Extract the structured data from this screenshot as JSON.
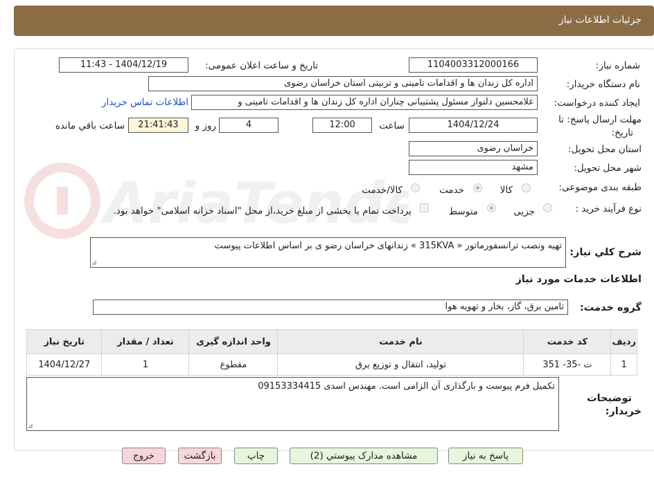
{
  "header": {
    "title": "جزئیات اطلاعات نیاز"
  },
  "fields": {
    "need_number_label": "شماره نیاز:",
    "need_number": "1104003312000166",
    "announce_label": "تاریخ و ساعت اعلان عمومی:",
    "announce_value": "1404/12/19 - 11:43",
    "buyer_org_label": "نام دستگاه خریدار:",
    "buyer_org": "اداره کل زندان ها و اقدامات تامینی و تربیتی استان خراسان رضوی",
    "requester_label": "ایجاد کننده درخواست:",
    "requester": "غلامحسین دلنواز مسئول پشتیبانی چناران اداره کل زندان ها و اقدامات تامینی و",
    "contact_link": "اطلاعات تماس خریدار",
    "deadline_label_1": "مهلت ارسال پاسخ: تا",
    "deadline_label_2": "تاریخ:",
    "deadline_date": "1404/12/24",
    "time_word": "ساعت",
    "deadline_time": "12:00",
    "days_value": "4",
    "days_word": "روز و",
    "remaining_time": "21:41:43",
    "remaining_word": "ساعت باقي مانده",
    "province_label": "استان محل تحویل:",
    "province": "خراسان رضوی",
    "city_label": "شهر محل تحویل:",
    "city": "مشهد",
    "category_label": "طبقه بندی موضوعی:",
    "category_options": [
      "کالا",
      "خدمت",
      "کالا/خدمت"
    ],
    "category_selected": "خدمت",
    "process_label": "نوع فرآیند خرید :",
    "process_options": [
      "جزیی",
      "متوسط"
    ],
    "process_selected": "متوسط",
    "payment_note": "پرداخت تمام یا بخشی از مبلغ خرید،از محل \"اسناد خزانه اسلامی\" خواهد بود."
  },
  "summary": {
    "label": "شرح کلي نیاز:",
    "text": "تهیه ونصب ترانسفورماتور « 315KVA » زندانهای خراسان رضو ی بر اساس اطلاعات پیوست"
  },
  "services": {
    "section_title": "اطلاعات خدمات مورد نیاز",
    "group_label": "گروه خدمت:",
    "group_value": "تامین برق، گاز، بخار و تهویه هوا",
    "columns": [
      "ردیف",
      "کد خدمت",
      "نام خدمت",
      "واحد اندازه گیری",
      "تعداد / مقدار",
      "تاریخ نیاز"
    ],
    "rows": [
      [
        "1",
        "ت -35- 351",
        "تولید، انتقال و توزیع برق",
        "مقطوع",
        "1",
        "1404/12/27"
      ]
    ]
  },
  "buyer_notes": {
    "label_1": "توضیحات",
    "label_2": "خریدار:",
    "text": "تکمیل فرم پیوست و بارگذاری آن الزامی است. مهندس اسدی 09153334415"
  },
  "buttons": {
    "reply": "پاسخ به نیاز",
    "docs": "مشاهده مدارک پیوستي (2)",
    "print": "چاپ",
    "back": "بازگشت",
    "exit": "خروج"
  },
  "colors": {
    "header_bg": "#8b6c45",
    "link": "#1a54c9",
    "green_btn": "#e6f5dc",
    "pink_btn": "#f6d6da",
    "yellow_box": "#fbf6d9"
  },
  "watermark": {
    "text": "AriaTender.neT"
  }
}
